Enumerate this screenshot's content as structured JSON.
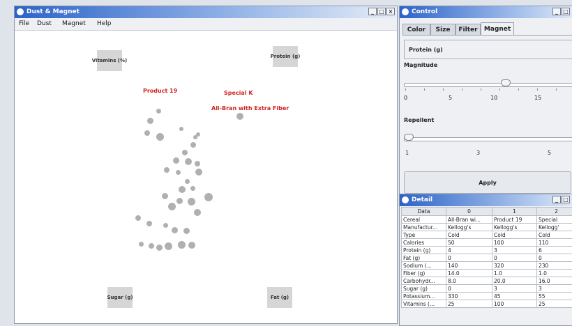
{
  "main_window": {
    "title": "Dust & Magnet",
    "btn_min": "_",
    "btn_max": "□",
    "btn_close": "×",
    "menu": [
      "File",
      "Dust",
      "Magnet",
      "Help"
    ]
  },
  "magnets": [
    {
      "name": "magnet-vitamins",
      "label": "Vitamins (%)"
    },
    {
      "name": "magnet-protein",
      "label": "Protein (g)"
    },
    {
      "name": "magnet-sugar",
      "label": "Sugar (g)"
    },
    {
      "name": "magnet-fat",
      "label": "Fat (g)"
    }
  ],
  "highlighted_labels": [
    "Product 19",
    "Special K",
    "All-Bran with Extra Fiber"
  ],
  "colors": {
    "highlight": "#d22222",
    "dust": "#b0b0b0",
    "magnet": "#d6d6d6"
  },
  "control": {
    "title": "Control",
    "tabs": [
      "Color",
      "Size",
      "Filter",
      "Magnet"
    ],
    "active_tab": "Magnet",
    "selected_magnet": "Protein (g)",
    "magnitude_label": "Magnitude",
    "magnitude_ticks": [
      "0",
      "5",
      "10",
      "15"
    ],
    "magnitude_value": 10,
    "repellent_label": "Repellent",
    "repellent_ticks": [
      "1",
      "3",
      "5"
    ],
    "repellent_value": 0,
    "apply_label": "Apply",
    "btn_min": "_",
    "btn_max": "□"
  },
  "detail": {
    "title": "Detail",
    "btn_min": "_",
    "btn_max": "□",
    "columns": [
      "Data",
      "0",
      "1",
      "2"
    ],
    "rows": [
      [
        "Cereal",
        "All-Bran wi...",
        "Product 19",
        "Special"
      ],
      [
        "Manufactur...",
        "Kellogg's",
        "Kellogg's",
        "Kellogg'"
      ],
      [
        "Type",
        "Cold",
        "Cold",
        "Cold"
      ],
      [
        "Calories",
        "50",
        "100",
        "110"
      ],
      [
        "Protein (g)",
        "4",
        "3",
        "6"
      ],
      [
        "Fat (g)",
        "0",
        "0",
        "0"
      ],
      [
        "Sodium (...",
        "140",
        "320",
        "230"
      ],
      [
        "Fiber (g)",
        "14.0",
        "1.0",
        "1.0"
      ],
      [
        "Carbohydr...",
        "8.0",
        "20.0",
        "16.0"
      ],
      [
        "Sugar (g)",
        "0",
        "3",
        "3"
      ],
      [
        "Potassium...",
        "330",
        "45",
        "55"
      ],
      [
        "Vitamins (...",
        "25",
        "100",
        "25"
      ]
    ]
  }
}
